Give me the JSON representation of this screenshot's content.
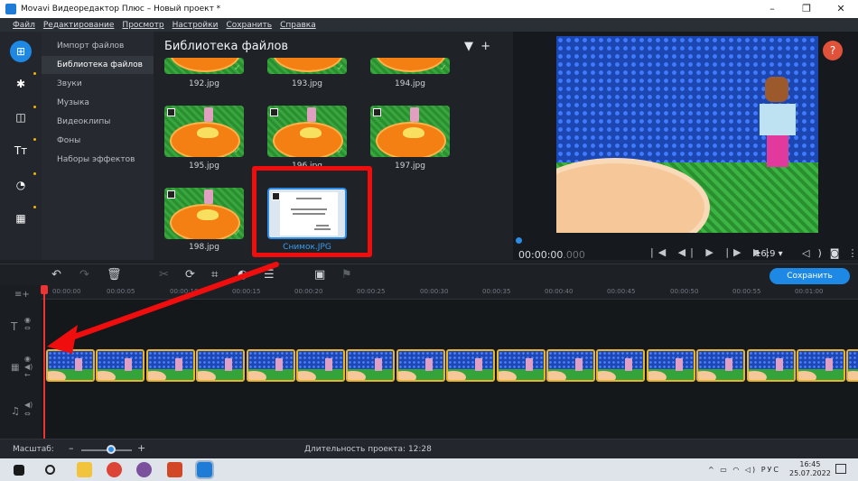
{
  "window": {
    "title": "Movavi Видеоредактор Плюс – Новый проект *",
    "min": "–",
    "max": "❐",
    "close": "✕"
  },
  "menu": [
    "Файл",
    "Редактирование",
    "Просмотр",
    "Настройки",
    "Сохранить",
    "Справка"
  ],
  "sidebar": {
    "categories": [
      "Импорт файлов",
      "Библиотека файлов",
      "Звуки",
      "Музыка",
      "Видеоклипы",
      "Фоны",
      "Наборы эффектов"
    ],
    "selected": "Библиотека файлов"
  },
  "library": {
    "title": "Библиотека файлов",
    "filter_icon": "filter-icon",
    "add_icon": "plus-icon",
    "files": [
      {
        "name": "192.jpg"
      },
      {
        "name": "193.jpg"
      },
      {
        "name": "194.jpg"
      },
      {
        "name": "195.jpg"
      },
      {
        "name": "196.jpg"
      },
      {
        "name": "197.jpg"
      },
      {
        "name": "198.jpg"
      },
      {
        "name": "Снимок.JPG"
      }
    ],
    "doc_lines": [
      "Мультфильм",
      "«Волшебный шалаш»"
    ]
  },
  "preview": {
    "help": "?",
    "timecode_main": "00:00:00",
    "timecode_ms": ".000",
    "aspect": "16:9 ▾"
  },
  "timeline": {
    "save_label": "Сохранить",
    "ruler": [
      "00:00:00",
      "00:00:05",
      "00:00:10",
      "00:00:15",
      "00:00:20",
      "00:00:25",
      "00:00:30",
      "00:00:35",
      "00:00:40",
      "00:00:45",
      "00:00:50",
      "00:00:55",
      "00:01:00"
    ]
  },
  "status": {
    "zoom_label": "Масштаб:",
    "zoom_minus": "–",
    "zoom_plus": "+",
    "duration": "Длительность проекта: 12:28"
  },
  "taskbar": {
    "lang": "РУС",
    "time": "16:45",
    "date": "25.07.2022"
  },
  "colors": {
    "accent": "#1d89e4",
    "highlight_red": "#f00d0d",
    "clip_border": "#e8b52a"
  }
}
